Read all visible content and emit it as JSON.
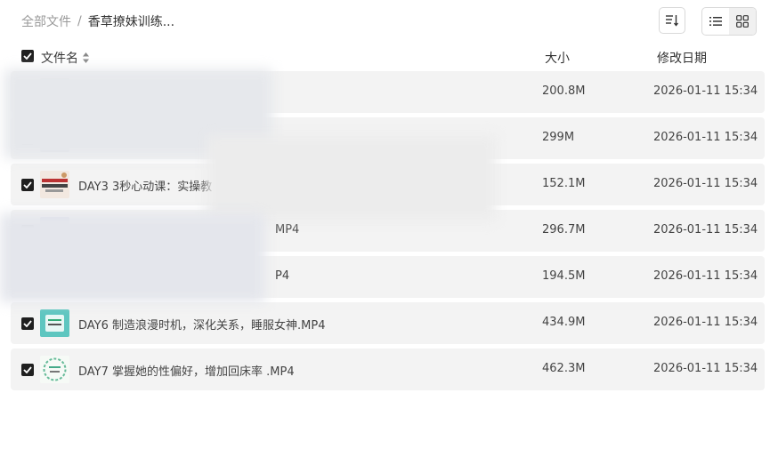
{
  "breadcrumb": {
    "root": "全部文件",
    "separator": "/",
    "current": "香草撩妹训练..."
  },
  "columns": {
    "name": "文件名",
    "size": "大小",
    "date": "修改日期"
  },
  "files": [
    {
      "name": "",
      "size": "200.8M",
      "date": "2026-01-11 15:34"
    },
    {
      "name": "",
      "size": "299M",
      "date": "2026-01-11 15:34"
    },
    {
      "name": "DAY3 3秒心动课：实操教",
      "size": "152.1M",
      "date": "2026-01-11 15:34"
    },
    {
      "name": "MP4",
      "size": "296.7M",
      "date": "2026-01-11 15:34"
    },
    {
      "name": "P4",
      "size": "194.5M",
      "date": "2026-01-11 15:34"
    },
    {
      "name": "DAY6 制造浪漫时机，深化关系，睡服女神.MP4",
      "size": "434.9M",
      "date": "2026-01-11 15:34"
    },
    {
      "name": "DAY7 掌握她的性偏好，增加回床率 .MP4",
      "size": "462.3M",
      "date": "2026-01-11 15:34"
    }
  ],
  "icons": {
    "sort": "sort-lines-icon",
    "list_view": "list-view-icon",
    "grid_view": "grid-view-icon",
    "check": "checkmark-icon"
  }
}
